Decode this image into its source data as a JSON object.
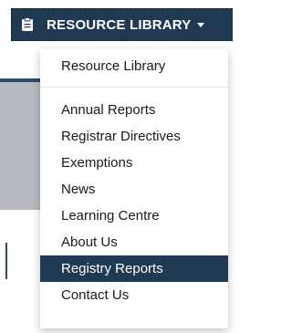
{
  "header": {
    "menu_label": "RESOURCE LIBRARY",
    "icon": "clipboard-icon",
    "caret_icon": "caret-down-icon",
    "background_color": "#1f3a52"
  },
  "menu": {
    "items": [
      {
        "label": "Resource Library"
      },
      {
        "label": "Annual Reports"
      },
      {
        "label": "Registrar Directives"
      },
      {
        "label": "Exemptions"
      },
      {
        "label": "News"
      },
      {
        "label": "Learning Centre"
      },
      {
        "label": "About Us"
      },
      {
        "label": "Registry Reports",
        "active": true
      },
      {
        "label": "Contact Us"
      }
    ],
    "active_background": "#1f3a52",
    "active_text_color": "#ffffff"
  }
}
